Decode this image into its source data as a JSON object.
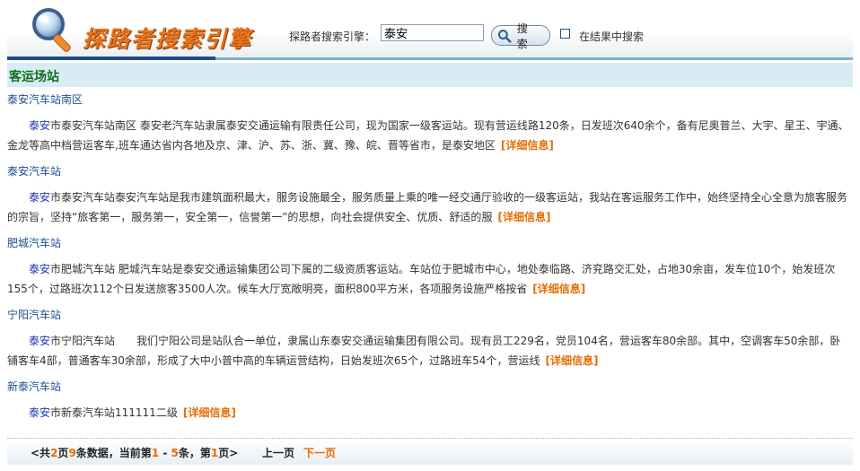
{
  "header": {
    "logo_text": "探路者搜索引擎",
    "search_label": "探路者搜索引擎：",
    "search_value": "泰安",
    "search_button_label": "搜 索",
    "search_within_label": "在结果中搜索"
  },
  "section": {
    "title": "客运场站"
  },
  "results": [
    {
      "title": "泰安汽车站南区",
      "keyword": "泰安",
      "description": "市泰安汽车站南区 泰安老汽车站隶属泰安交通运输有限责任公司，现为国家一级客运站。现有营运线路120条，日发班次640余个，备有尼奥普兰、大宇、星王、宇通、金龙等高中档营运客车,班车通达省内各地及京、津、沪、苏、浙、冀、豫、皖、晋等省市，是泰安地区",
      "more_label": "[详细信息]"
    },
    {
      "title": "泰安汽车站",
      "keyword": "泰安",
      "description": "市泰安汽车站泰安汽车站是我市建筑面积最大，服务设施最全，服务质量上乘的唯一经交通厅验收的一级客运站，我站在客运服务工作中，始终坚持全心全意为旅客服务的宗旨，坚持“旅客第一，服务第一，安全第一，信誉第一”的思想，向社会提供安全、优质、舒适的服",
      "more_label": "[详细信息]"
    },
    {
      "title": "肥城汽车站",
      "keyword": "泰安",
      "description": "市肥城汽车站 肥城汽车站是泰安交通运输集团公司下属的二级资质客运站。车站位于肥城市中心，地处泰临路、济兖路交汇处，占地30余亩，发车位10个，始发班次155个，过路班次112个日发送旅客3500人次。候车大厅宽敞明亮，面积800平方米，各项服务设施严格按省",
      "more_label": "[详细信息]"
    },
    {
      "title": "宁阳汽车站",
      "keyword": "泰安",
      "description": "市宁阳汽车站　　我们宁阳公司是站队合一单位，隶属山东泰安交通运输集团有限公司。现有员工229名，党员104名，营运客车80余部。其中，空调客车50余部，卧铺客车4部，普通客车30余部，形成了大中小普中高的车辆运营结构，日始发班次65个，过路班车54个，营运线",
      "more_label": "[详细信息]"
    },
    {
      "title": "新泰汽车站",
      "keyword": "泰安",
      "description": "市新泰汽车站111111二级",
      "more_label": "[详细信息]"
    }
  ],
  "pager": {
    "open": "<共",
    "total_pages": "2",
    "pages_unit": "页",
    "total_records": "9",
    "records_text": "条数据，当前第",
    "range_start": "1",
    "range_sep": " - ",
    "range_end": "5",
    "range_unit": "条，第",
    "current_page": "1",
    "close": "页>",
    "prev_label": "上一页",
    "next_label": "下一页"
  },
  "colors": {
    "link": "#1b4f91",
    "highlight": "#e86b00",
    "section_title": "#0e6e1c",
    "section_bg": "#d9ecf5",
    "brand": "#e8731a"
  },
  "icons": {
    "logo": "magnifier-icon",
    "search_button": "magnifier-icon"
  }
}
